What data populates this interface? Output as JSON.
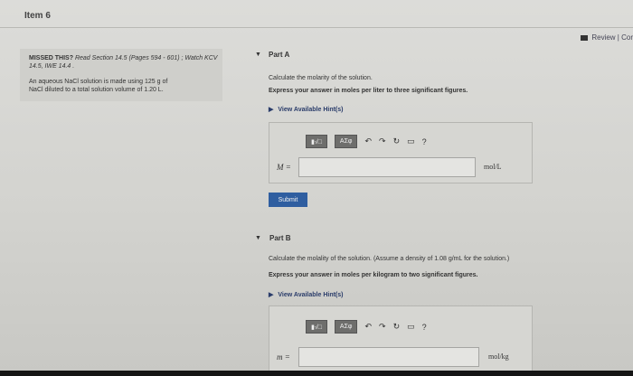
{
  "header": {
    "item_title": "Item 6",
    "review_label": "Review | Cor"
  },
  "sidebar": {
    "missed_title": "MISSED THIS?",
    "missed_text": "Read Section 14.5 (Pages 594 - 601) ; Watch KCV 14.5, IWE 14.4 .",
    "problem_line1": "An aqueous NaCl solution is made using 125 g of",
    "problem_line2": "NaCl diluted to a total solution volume of 1.20 L."
  },
  "partA": {
    "label": "Part A",
    "question": "Calculate the molarity of the solution.",
    "instruction": "Express your answer in moles per liter to three significant figures.",
    "hint_label": "View Available Hint(s)",
    "variable": "M =",
    "unit": "mol/L",
    "input_value": "",
    "submit_label": "Submit"
  },
  "partB": {
    "label": "Part B",
    "question": "Calculate the molality of the solution. (Assume a density of 1.08 g/mL for the solution.)",
    "instruction": "Express your answer in moles per kilogram to two significant figures.",
    "hint_label": "View Available Hint(s)",
    "variable": "m =",
    "unit": "mol/kg",
    "input_value": ""
  },
  "toolbar": {
    "template_btn": "▮√□",
    "greek_btn": "ΑΣφ",
    "undo": "↶",
    "redo": "↷",
    "reset": "↻",
    "keyboard": "▭",
    "help": "?"
  }
}
